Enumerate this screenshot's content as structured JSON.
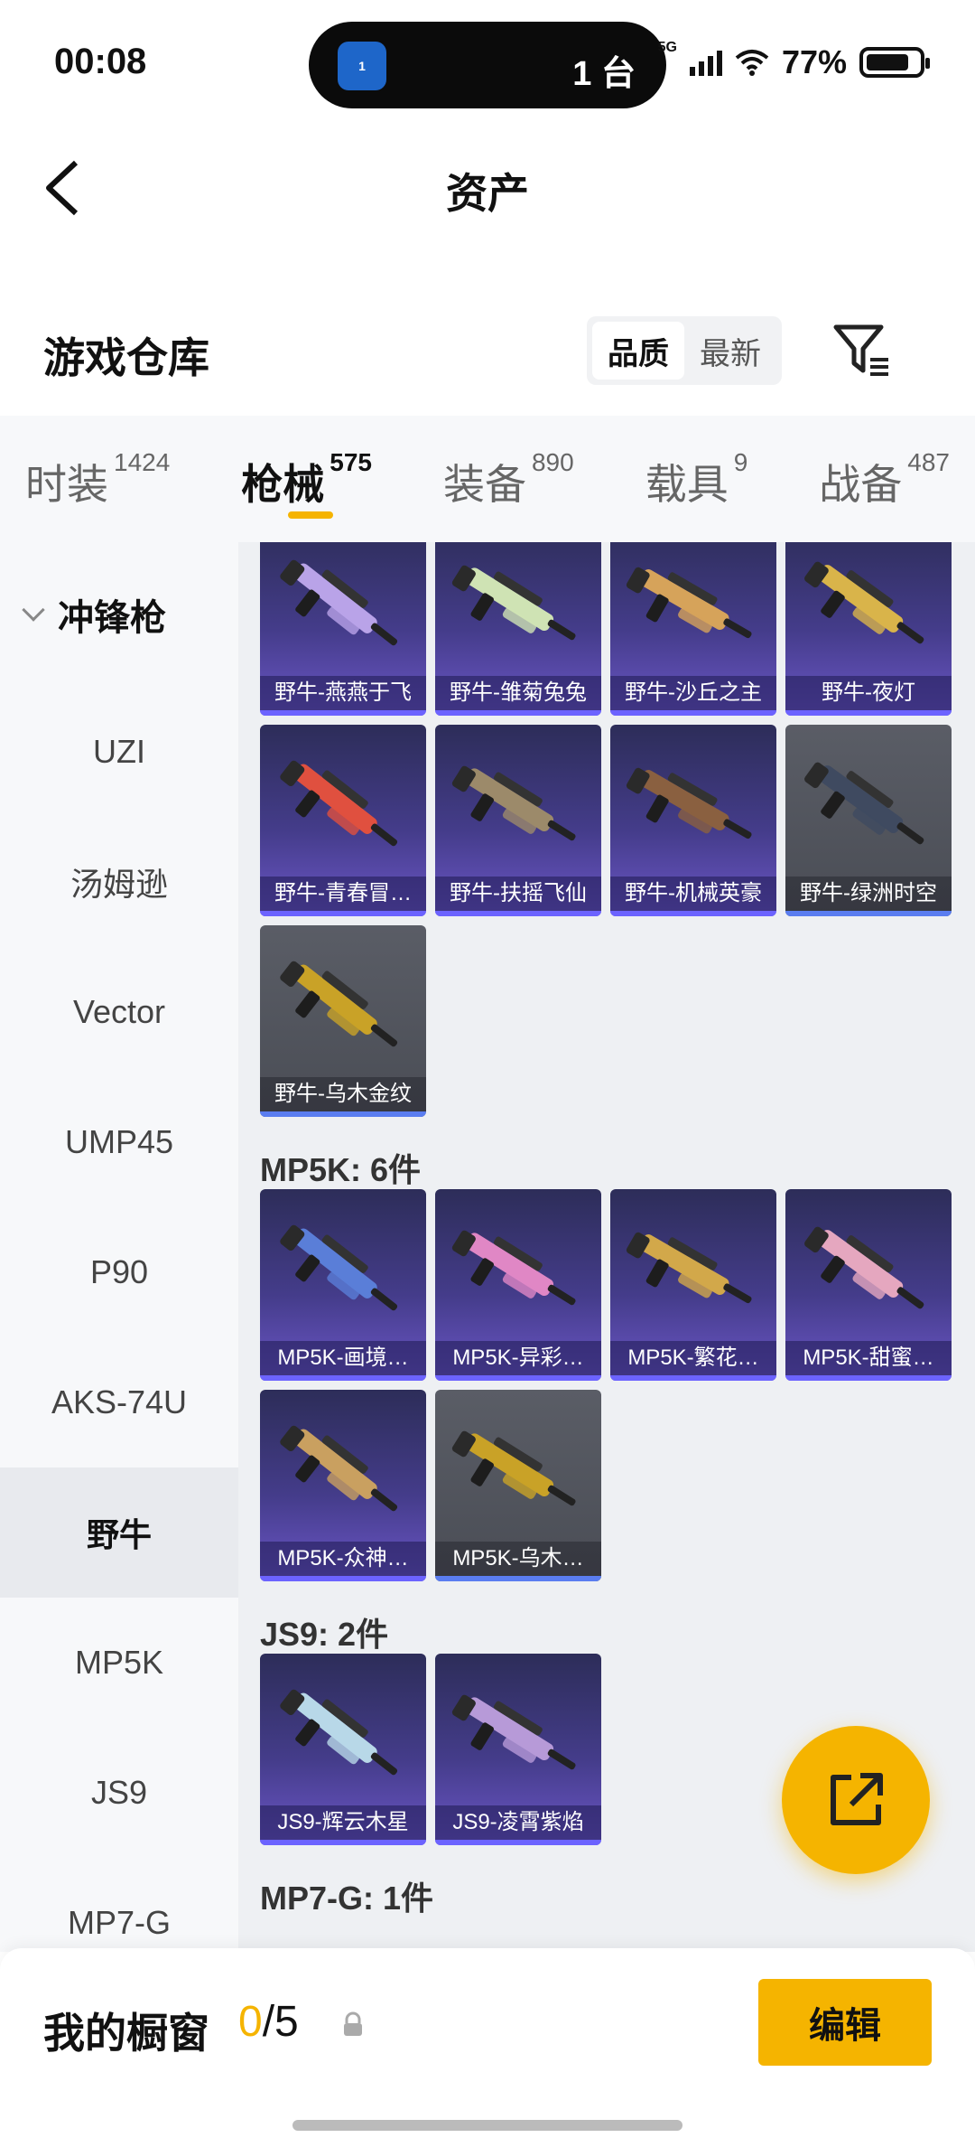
{
  "status": {
    "time": "00:08",
    "island_text": "1 台",
    "island_badge": "1",
    "network": "5G",
    "battery": "77%"
  },
  "header": {
    "title": "资产"
  },
  "warehouse": {
    "title": "游戏仓库",
    "sort_options": [
      "品质",
      "最新"
    ],
    "sort_selected": "品质"
  },
  "tabs": [
    {
      "label": "时装",
      "count": "1424"
    },
    {
      "label": "枪械",
      "count": "575"
    },
    {
      "label": "装备",
      "count": "890"
    },
    {
      "label": "载具",
      "count": "9"
    },
    {
      "label": "战备",
      "count": "487"
    }
  ],
  "sidebar": {
    "group": "冲锋枪",
    "items": [
      "UZI",
      "汤姆逊",
      "Vector",
      "UMP45",
      "P90",
      "AKS-74U",
      "野牛",
      "MP5K",
      "JS9",
      "MP7-G"
    ],
    "selected": "野牛"
  },
  "sections": [
    {
      "title": "",
      "items": [
        {
          "name": "野牛-燕燕于飞",
          "rarity": "purple",
          "color": "#b9a3e8"
        },
        {
          "name": "野牛-雏菊兔兔",
          "rarity": "purple",
          "color": "#cfe3b4"
        },
        {
          "name": "野牛-沙丘之主",
          "rarity": "purple",
          "color": "#d6a35a"
        },
        {
          "name": "野牛-夜灯",
          "rarity": "purple",
          "color": "#d9b44a"
        },
        {
          "name": "野牛-青春冒…",
          "rarity": "purple",
          "color": "#e0503f"
        },
        {
          "name": "野牛-扶摇飞仙",
          "rarity": "purple",
          "color": "#9c8a6a"
        },
        {
          "name": "野牛-机械英豪",
          "rarity": "purple",
          "color": "#8a6040"
        },
        {
          "name": "野牛-绿洲时空",
          "rarity": "grey",
          "color": "#3f4a60"
        },
        {
          "name": "野牛-乌木金纹",
          "rarity": "grey",
          "color": "#c9a227"
        }
      ]
    },
    {
      "title": "MP5K: 6件",
      "items": [
        {
          "name": "MP5K-画境…",
          "rarity": "purple",
          "color": "#5a7ed8"
        },
        {
          "name": "MP5K-异彩…",
          "rarity": "purple",
          "color": "#e087c5"
        },
        {
          "name": "MP5K-繁花…",
          "rarity": "purple",
          "color": "#d2a84a"
        },
        {
          "name": "MP5K-甜蜜…",
          "rarity": "purple",
          "color": "#e5a7bf"
        },
        {
          "name": "MP5K-众神…",
          "rarity": "purple",
          "color": "#c9a060"
        },
        {
          "name": "MP5K-乌木…",
          "rarity": "grey",
          "color": "#c9a227"
        }
      ]
    },
    {
      "title": "JS9: 2件",
      "items": [
        {
          "name": "JS9-辉云木星",
          "rarity": "purple",
          "color": "#b8d8e8"
        },
        {
          "name": "JS9-凌霄紫焰",
          "rarity": "purple",
          "color": "#b79ad8"
        }
      ]
    },
    {
      "title": "MP7-G: 1件",
      "items": []
    }
  ],
  "showcase": {
    "label": "我的橱窗",
    "current": "0",
    "separator": "/5",
    "edit_label": "编辑"
  },
  "colors": {
    "accent": "#f5b400",
    "card_purple": "#443c8a",
    "card_grey": "#4a4d55"
  },
  "icons": {
    "back": "back-arrow-icon",
    "filter": "filter-icon",
    "share": "share-external-icon",
    "lock": "lock-icon"
  }
}
